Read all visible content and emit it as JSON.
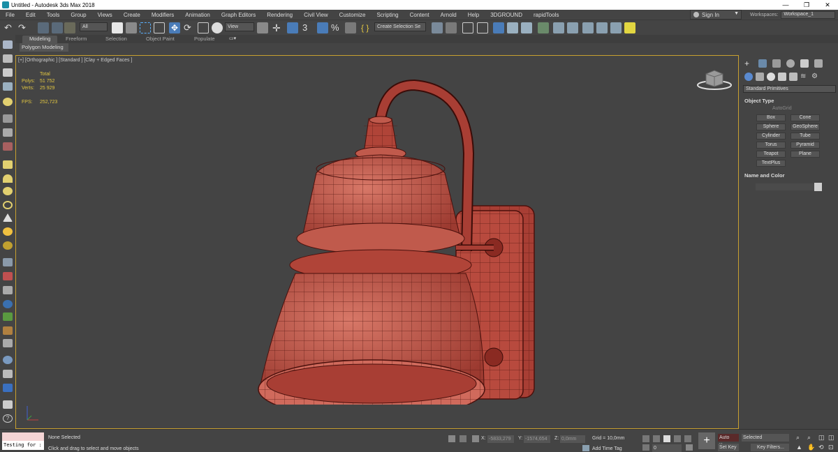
{
  "window": {
    "title": "Untitled - Autodesk 3ds Max 2018",
    "controls": [
      "—",
      "❐",
      "✕"
    ]
  },
  "menu": [
    "File",
    "Edit",
    "Tools",
    "Group",
    "Views",
    "Create",
    "Modifiers",
    "Animation",
    "Graph Editors",
    "Rendering",
    "Civil View",
    "Customize",
    "Scripting",
    "Content",
    "Arnold",
    "Help",
    "3DGROUND",
    "rapidTools"
  ],
  "account": {
    "sign_in": "Sign In",
    "workspaces_label": "Workspaces:",
    "workspace": "Workspace_1"
  },
  "toolbar": {
    "selection_filter": "All",
    "view_dropdown": "View",
    "create_selection_set": "Create Selection Se",
    "snap_angle": "3",
    "percent_snap": "%"
  },
  "ribbon": {
    "tabs": [
      "Modeling",
      "Freeform",
      "Selection",
      "Object Paint",
      "Populate"
    ],
    "active": "Modeling",
    "panel_label": "Polygon Modeling"
  },
  "viewport": {
    "label": "[+] [Orthographic ] [Standard ] [Clay + Edged Faces ]",
    "stats": {
      "header": "Total",
      "polys_label": "Polys:",
      "polys": "51 752",
      "verts_label": "Verts:",
      "verts": "25 929",
      "fps_label": "FPS:",
      "fps": "252,723"
    }
  },
  "command_panel": {
    "category": "Standard Primitives",
    "object_type_header": "Object Type",
    "autogrid": "AutoGrid",
    "buttons": [
      "Box",
      "Cone",
      "Sphere",
      "GeoSphere",
      "Cylinder",
      "Tube",
      "Torus",
      "Pyramid",
      "Teapot",
      "Plane",
      "TextPlus"
    ],
    "name_color_header": "Name and Color"
  },
  "status": {
    "maxscript_text": "Testing for :",
    "selection": "None Selected",
    "prompt": "Click and drag to select and move objects",
    "x_label": "X:",
    "x_value": "-5833,279",
    "y_label": "Y:",
    "y_value": "-1574,654",
    "z_label": "Z:",
    "z_value": "0,0mm",
    "grid": "Grid = 10,0mm",
    "add_time_tag": "Add Time Tag",
    "frame": "0",
    "auto_key": "Auto Key",
    "set_key": "Set Key",
    "key_mode": "Selected",
    "key_filters": "Key Filters..."
  }
}
